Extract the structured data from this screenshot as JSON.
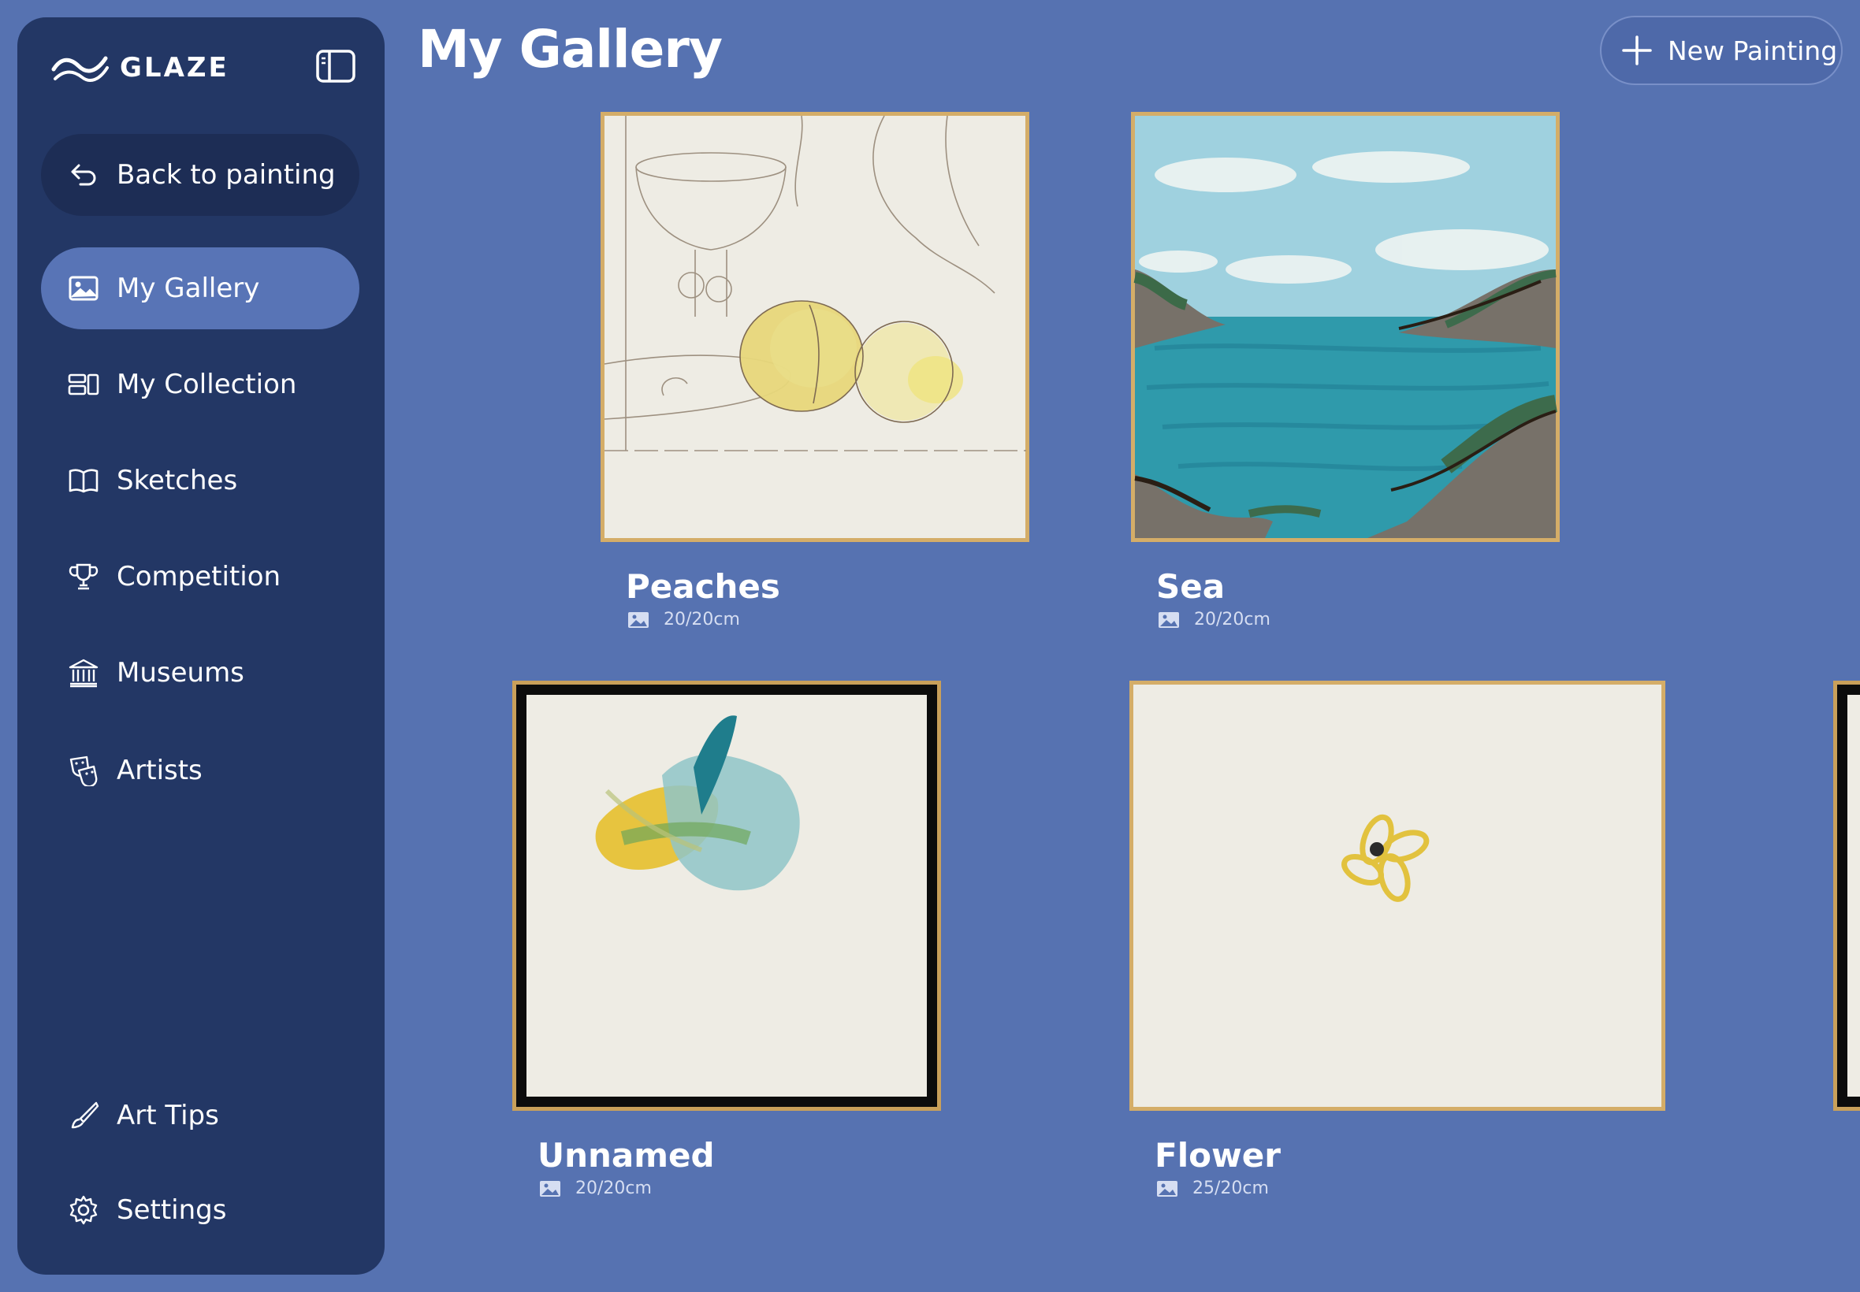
{
  "app": {
    "name": "GLAZE"
  },
  "sidebar": {
    "back": "Back to painting",
    "items": [
      {
        "label": "My Gallery",
        "active": true,
        "icon": "image-icon"
      },
      {
        "label": "My Collection",
        "active": false,
        "icon": "collection-icon"
      },
      {
        "label": "Sketches",
        "active": false,
        "icon": "book-icon"
      },
      {
        "label": "Competition",
        "active": false,
        "icon": "trophy-icon"
      },
      {
        "label": "Museums",
        "active": false,
        "icon": "museum-icon"
      },
      {
        "label": "Artists",
        "active": false,
        "icon": "masks-icon"
      },
      {
        "label": "Art Tips",
        "active": false,
        "icon": "brush-icon"
      },
      {
        "label": "Settings",
        "active": false,
        "icon": "gear-icon"
      }
    ]
  },
  "header": {
    "title": "My Gallery",
    "new_button": "New Painting"
  },
  "gallery": {
    "paintings": [
      {
        "title": "Peaches",
        "size": "20/20cm"
      },
      {
        "title": "Sea",
        "size": "20/20cm"
      },
      {
        "title": "Unnamed",
        "size": "20/20cm"
      },
      {
        "title": "Flower",
        "size": "25/20cm"
      }
    ]
  },
  "colors": {
    "background": "#5672b1",
    "sidebar": "#233765",
    "active_item": "#5874b6",
    "gold_frame": "#d4ad68"
  }
}
